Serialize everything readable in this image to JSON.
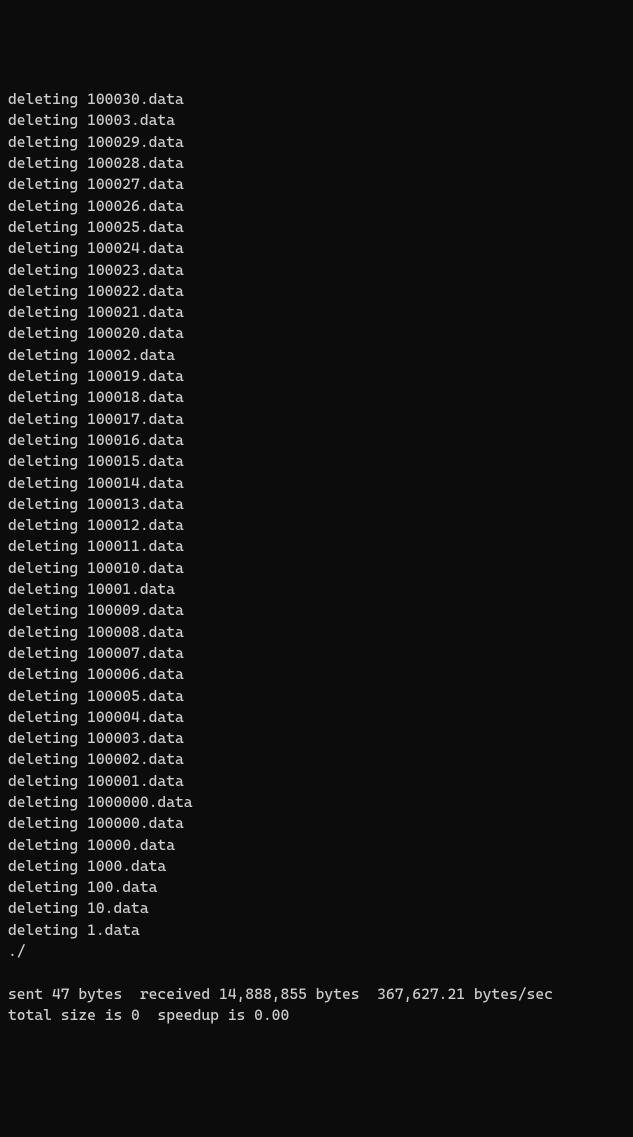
{
  "terminal": {
    "deletion_prefix": "deleting ",
    "deleted_files": [
      "100030.data",
      "10003.data",
      "100029.data",
      "100028.data",
      "100027.data",
      "100026.data",
      "100025.data",
      "100024.data",
      "100023.data",
      "100022.data",
      "100021.data",
      "100020.data",
      "10002.data",
      "100019.data",
      "100018.data",
      "100017.data",
      "100016.data",
      "100015.data",
      "100014.data",
      "100013.data",
      "100012.data",
      "100011.data",
      "100010.data",
      "10001.data",
      "100009.data",
      "100008.data",
      "100007.data",
      "100006.data",
      "100005.data",
      "100004.data",
      "100003.data",
      "100002.data",
      "100001.data",
      "1000000.data",
      "100000.data",
      "10000.data",
      "1000.data",
      "100.data",
      "10.data",
      "1.data"
    ],
    "directory_line": "./",
    "summary": {
      "line1": "sent 47 bytes  received 14,888,855 bytes  367,627.21 bytes/sec",
      "line2": "total size is 0  speedup is 0.00"
    }
  }
}
